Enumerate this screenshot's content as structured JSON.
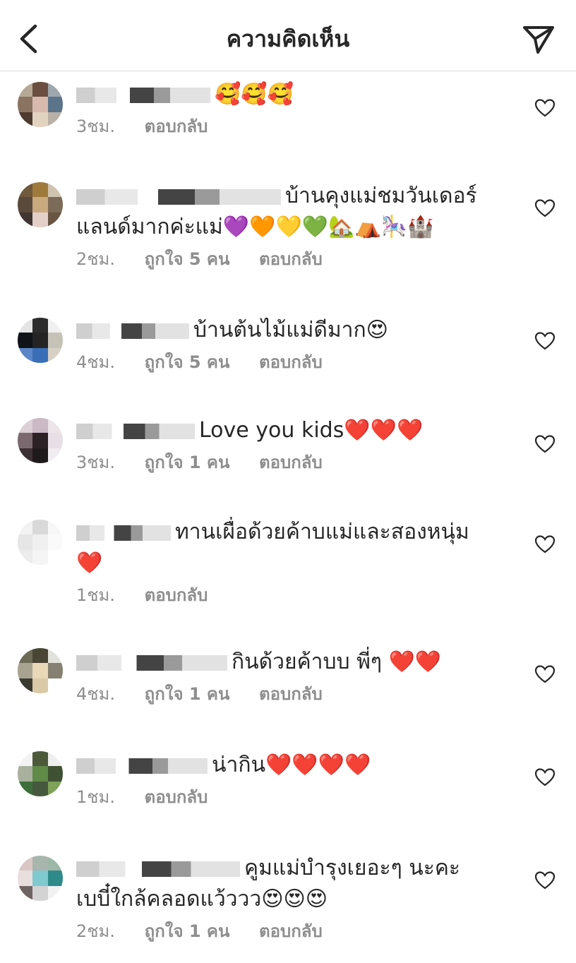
{
  "header": {
    "title": "ความคิดเห็น"
  },
  "comments": [
    {
      "text": "🥰🥰🥰",
      "time": "3ชม.",
      "likes": "",
      "reply": "ตอบกลับ",
      "text2": ""
    },
    {
      "text": "บ้านคุงแม่ชมวันเดอร์",
      "text2": "แลนด์มากค่ะแม่💜🧡💛💚🏡⛺🎠🏰",
      "time": "2ชม.",
      "likes": "ถูกใจ 5 คน",
      "reply": "ตอบกลับ"
    },
    {
      "text": "บ้านต้นไม้แม่ดีมาก😍",
      "text2": "",
      "time": "4ชม.",
      "likes": "ถูกใจ 5 คน",
      "reply": "ตอบกลับ"
    },
    {
      "text": "Love you kids❤️❤️❤️",
      "text2": "",
      "time": "3ชม.",
      "likes": "ถูกใจ 1 คน",
      "reply": "ตอบกลับ"
    },
    {
      "text": "ทานเผื่อด้วยค้าบแม่และสองหนุ่ม",
      "text2": "❤️",
      "time": "1ชม.",
      "likes": "",
      "reply": "ตอบกลับ"
    },
    {
      "text": "กินด้วยค้าบบ พี่ๆ ❤️❤️",
      "text2": "",
      "time": "4ชม.",
      "likes": "ถูกใจ 1 คน",
      "reply": "ตอบกลับ"
    },
    {
      "text": "น่ากิน❤️❤️❤️❤️",
      "text2": "",
      "time": "1ชม.",
      "likes": "",
      "reply": "ตอบกลับ"
    },
    {
      "text": "คูมแม่บำรุงเยอะๆ นะคะ",
      "text2": "เบบี๋ใกล้คลอดแว้ววว😍😍😍",
      "time": "2ชม.",
      "likes": "ถูกใจ 1 คน",
      "reply": "ตอบกลับ"
    }
  ],
  "icons": {
    "back": "chevron-left-icon",
    "send": "paper-plane-icon",
    "like": "heart-outline-icon"
  }
}
